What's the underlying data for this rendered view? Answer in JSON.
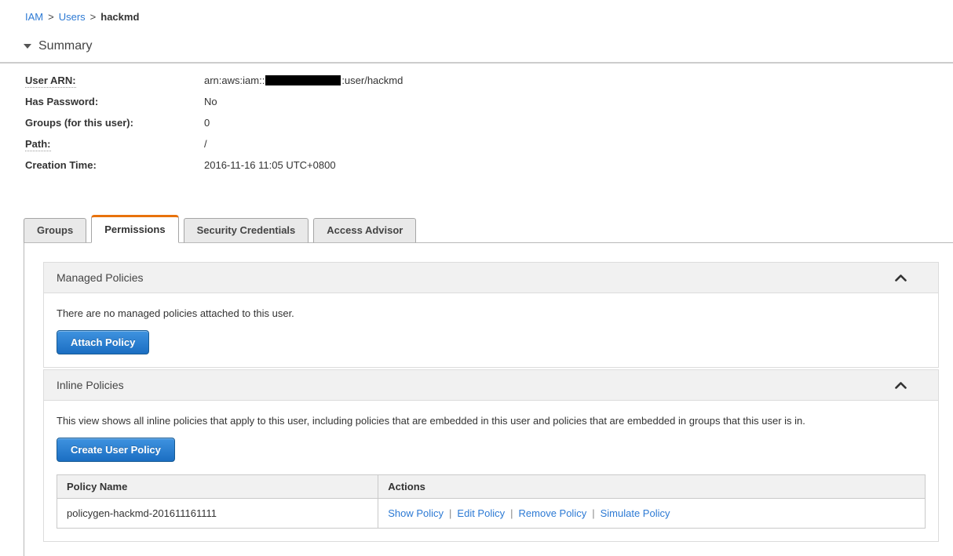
{
  "breadcrumb": {
    "separator": ">",
    "items": [
      {
        "label": "IAM"
      },
      {
        "label": "Users"
      },
      {
        "label": "hackmd"
      }
    ]
  },
  "summary": {
    "title": "Summary",
    "fields": [
      {
        "label": "User ARN:",
        "value_prefix": "arn:aws:iam::",
        "value_suffix": ":user/hackmd",
        "redacted": true
      },
      {
        "label": "Has Password:",
        "value": "No"
      },
      {
        "label": "Groups (for this user):",
        "value": "0"
      },
      {
        "label": "Path:",
        "value": "/"
      },
      {
        "label": "Creation Time:",
        "value": "2016-11-16 11:05 UTC+0800"
      }
    ]
  },
  "tabs": [
    {
      "label": "Groups",
      "active": false
    },
    {
      "label": "Permissions",
      "active": true
    },
    {
      "label": "Security Credentials",
      "active": false
    },
    {
      "label": "Access Advisor",
      "active": false
    }
  ],
  "managed_policies": {
    "title": "Managed Policies",
    "empty_text": "There are no managed policies attached to this user.",
    "attach_button": "Attach Policy"
  },
  "inline_policies": {
    "title": "Inline Policies",
    "description": "This view shows all inline policies that apply to this user, including policies that are embedded in this user and policies that are embedded in groups that this user is in.",
    "create_button": "Create User Policy",
    "table": {
      "headers": [
        "Policy Name",
        "Actions"
      ],
      "separator": "|",
      "rows": [
        {
          "policy_name": "policygen-hackmd-201611161111",
          "actions": [
            "Show Policy",
            "Edit Policy",
            "Remove Policy",
            "Simulate Policy"
          ]
        }
      ]
    }
  },
  "colors": {
    "accent_orange": "#e8720c",
    "link_blue": "#2d7ad4",
    "button_blue_top": "#3f93e0",
    "button_blue_bottom": "#1b6ec2"
  }
}
